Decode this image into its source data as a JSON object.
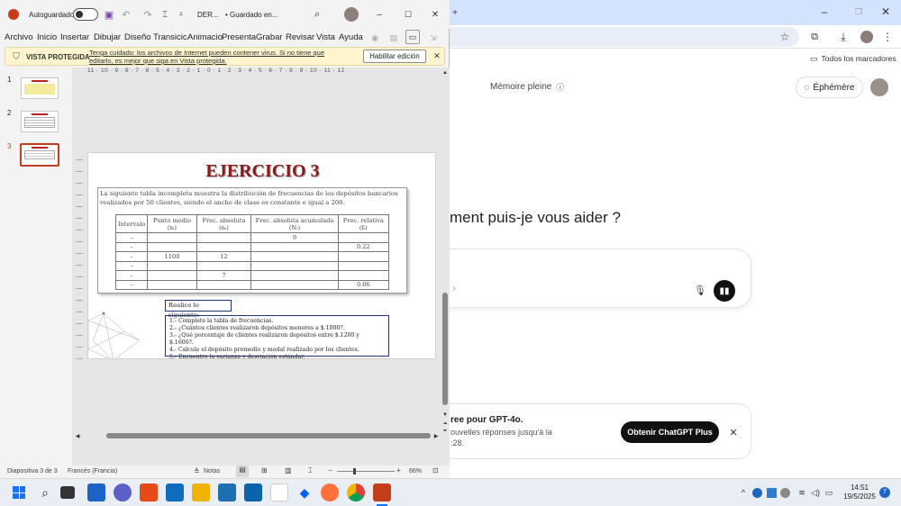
{
  "chrome": {
    "bookmarks_label": "Todos los marcadores",
    "memory_label": "Mémoire pleine",
    "ephemeral_label": "Éphémère",
    "heading": "ment puis-je vous aider ?",
    "promo_title": "ree pour GPT-4o.",
    "promo_line1": "ouvelles réponses jusqu'à la",
    "promo_line2": ":28.",
    "promo_button": "Obtenir ChatGPT Plus"
  },
  "ppt": {
    "autosave_label": "Autoguardado",
    "file_name": "DER...",
    "save_status": "• Guardado en...",
    "menu": [
      "Archivo",
      "Inicio",
      "Insertar",
      "Dibujar",
      "Diseño",
      "Transicic",
      "Animacio",
      "Presenta",
      "Grabar",
      "Revisar",
      "Vista",
      "Ayuda"
    ],
    "protected_label": "VISTA PROTEGIDA",
    "protected_msg_line1": "Tenga cuidado: los archivos de Internet pueden contener virus. Si no tiene que",
    "protected_msg_line2": "editarlo, es mejor que siga en Vista protegida.",
    "enable_edit_button": "Habilitar edición",
    "ruler_text": "11 · 10 · 9 · 8 · 7 · 6 · 5 · 4 · 3 · 2 · 1 · 0 · 1 · 2 · 3 · 4 · 5 · 6 · 7 · 8 · 9 · 10 · 11 · 12",
    "thumbnails": [
      "1",
      "2",
      "3"
    ],
    "status_slide": "Diapositiva 3 de 3",
    "status_lang": "Francés (Francia)",
    "status_notes": "Notas",
    "zoom": "66%"
  },
  "slide": {
    "title": "EJERCICIO 3",
    "intro": "La siguiente tabla incompleta muestra la distribución de frecuencias de los depósitos bancarios realizados por 50 clientes, siendo el ancho de clase es constante e igual a 200.",
    "headers": [
      "Intervalo",
      "Punto medio (xᵢ)",
      "Frec. absoluta (nᵢ)",
      "Frec. absoluta acumulada (Nᵢ)",
      "Frec. relativa (fᵢ)"
    ],
    "rows": [
      [
        "–",
        "",
        "",
        "9",
        ""
      ],
      [
        "–",
        "",
        "",
        "",
        "0.22"
      ],
      [
        "–",
        "1100",
        "12",
        "",
        ""
      ],
      [
        "–",
        "",
        "",
        "",
        ""
      ],
      [
        "–",
        "",
        "7",
        "",
        ""
      ],
      [
        "–",
        "",
        "",
        "",
        "0.06"
      ]
    ],
    "task_label": "Realice lo siguiente:",
    "tasks": [
      "1.- Complete la tabla de frecuencias.",
      "2.- ¿Cuántos clientes realizaron depósitos menores a $.1000?.",
      "3.- ¿Qué porcentaje de clientes realizaron depósitos entre $.1200 y $.1600?.",
      "4.- Calcule el depósito promedio y modal realizado por los clientes.",
      "5.- Encuentre la varianza y desviación estándar."
    ]
  },
  "taskbar": {
    "time": "14:51",
    "date": "19/5/2025",
    "notification_count": "7"
  },
  "colors": {
    "ppt_accent": "#c43e1c",
    "title_red": "#8b1a1a",
    "promo_button": "#111111"
  }
}
